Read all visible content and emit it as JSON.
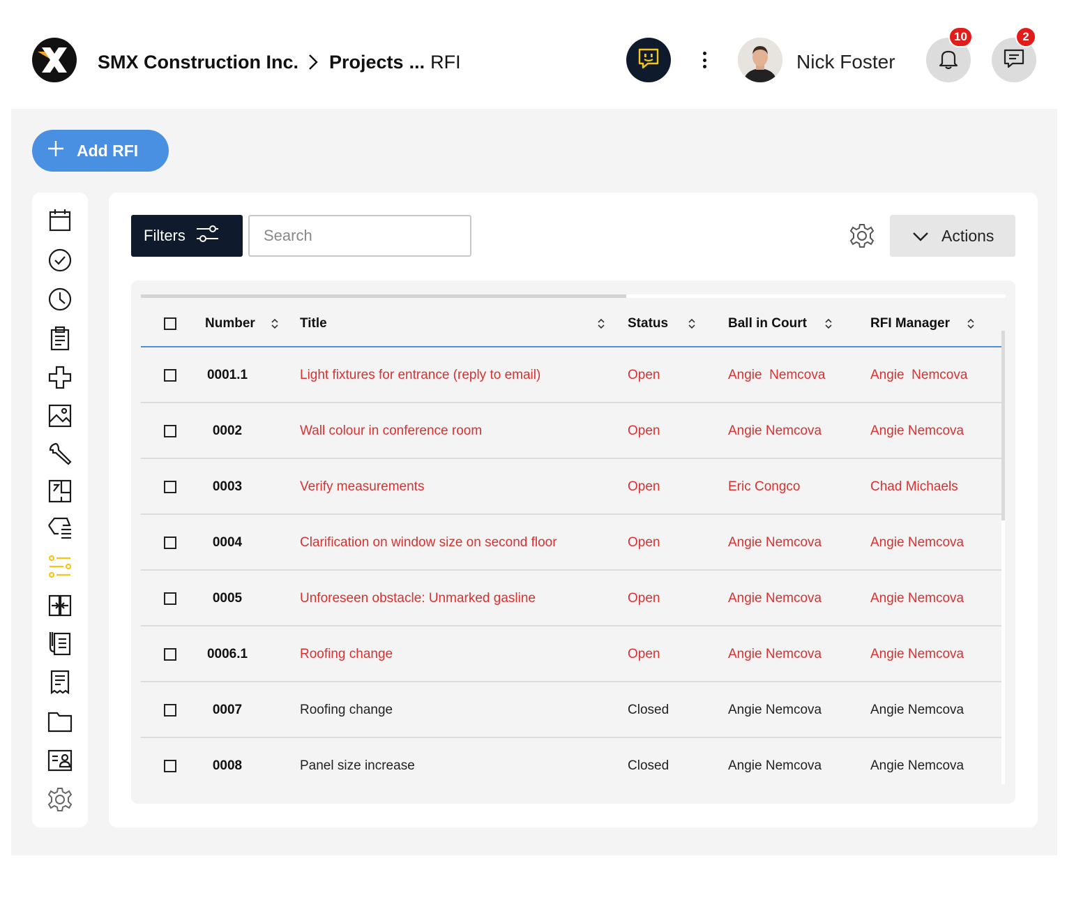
{
  "header": {
    "breadcrumb": {
      "company": "SMX Construction Inc.",
      "projects": "Projects",
      "ellipsis": "...",
      "current": "RFI"
    },
    "user": {
      "name": "Nick Foster"
    },
    "notifications": {
      "count": "10"
    },
    "messages": {
      "count": "2"
    },
    "icons": [
      "smx-logo-icon",
      "assistant-chat-icon",
      "more-vertical-icon",
      "bell-icon",
      "message-icon"
    ]
  },
  "toolbar": {
    "add_label": "Add RFI",
    "filters_label": "Filters",
    "search_placeholder": "Search",
    "actions_label": "Actions"
  },
  "sidebar": {
    "items": [
      {
        "icon": "calendar-icon"
      },
      {
        "icon": "check-circle-icon"
      },
      {
        "icon": "clock-icon"
      },
      {
        "icon": "clipboard-icon"
      },
      {
        "icon": "puzzle-icon"
      },
      {
        "icon": "image-icon"
      },
      {
        "icon": "wrench-icon"
      },
      {
        "icon": "floorplan-icon"
      },
      {
        "icon": "tag-list-icon"
      },
      {
        "icon": "rfi-options-icon",
        "active": true
      },
      {
        "icon": "transfer-icon"
      },
      {
        "icon": "specs-icon"
      },
      {
        "icon": "receipt-icon"
      },
      {
        "icon": "folder-icon"
      },
      {
        "icon": "contact-card-icon"
      },
      {
        "icon": "settings-icon"
      }
    ],
    "active_color": "#f5c518"
  },
  "table": {
    "columns": [
      "Number",
      "Title",
      "Status",
      "Ball in Court",
      "RFI Manager"
    ],
    "rows": [
      {
        "number": "0001.1",
        "title": "Light fixtures for entrance (reply to email)",
        "status": "Open",
        "ball_in_court": "Angie  Nemcova",
        "rfi_manager": "Angie  Nemcova"
      },
      {
        "number": "0002",
        "title": "Wall colour in conference room",
        "status": "Open",
        "ball_in_court": "Angie Nemcova",
        "rfi_manager": "Angie Nemcova"
      },
      {
        "number": "0003",
        "title": "Verify measurements",
        "status": "Open",
        "ball_in_court": "Eric Congco",
        "rfi_manager": "Chad Michaels"
      },
      {
        "number": "0004",
        "title": "Clarification on window size on second floor",
        "status": "Open",
        "ball_in_court": "Angie Nemcova",
        "rfi_manager": "Angie Nemcova"
      },
      {
        "number": "0005",
        "title": "Unforeseen obstacle: Unmarked gasline",
        "status": "Open",
        "ball_in_court": "Angie Nemcova",
        "rfi_manager": "Angie Nemcova"
      },
      {
        "number": "0006.1",
        "title": "Roofing change",
        "status": "Open",
        "ball_in_court": "Angie Nemcova",
        "rfi_manager": "Angie Nemcova"
      },
      {
        "number": "0007",
        "title": "Roofing change",
        "status": "Closed",
        "ball_in_court": "Angie Nemcova",
        "rfi_manager": "Angie Nemcova"
      },
      {
        "number": "0008",
        "title": "Panel size increase",
        "status": "Closed",
        "ball_in_court": "Angie Nemcova",
        "rfi_manager": "Angie Nemcova"
      }
    ]
  },
  "colors": {
    "accent": "#4a90e2",
    "dark": "#0f1b2d",
    "open_status": "#d93030",
    "badge": "#e21b1b"
  }
}
